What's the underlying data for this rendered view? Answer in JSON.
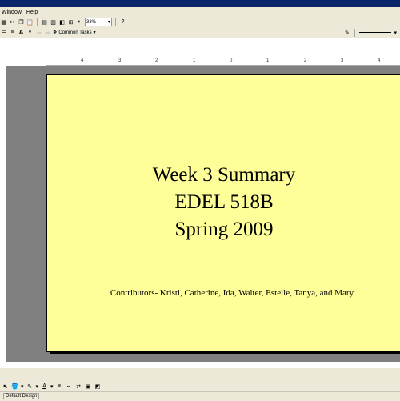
{
  "menu": {
    "window": "Window",
    "help": "Help"
  },
  "toolbar": {
    "zoom": "33%",
    "help_icon": "?",
    "common_tasks": "Common Tasks"
  },
  "slide": {
    "title_lines": [
      "Week 3 Summary",
      "EDEL 518B",
      "Spring 2009"
    ],
    "contributors": "Contributors- Kristi, Catherine, Ida, Walter, Estelle, Tanya, and Mary"
  },
  "ruler": {
    "labels": [
      "4",
      "3",
      "2",
      "1",
      "0",
      "1",
      "2",
      "3",
      "4"
    ]
  },
  "status": {
    "design": "Default Design"
  },
  "colors": {
    "slide_bg": "#ffff99",
    "titlebar": "#0a246a"
  }
}
